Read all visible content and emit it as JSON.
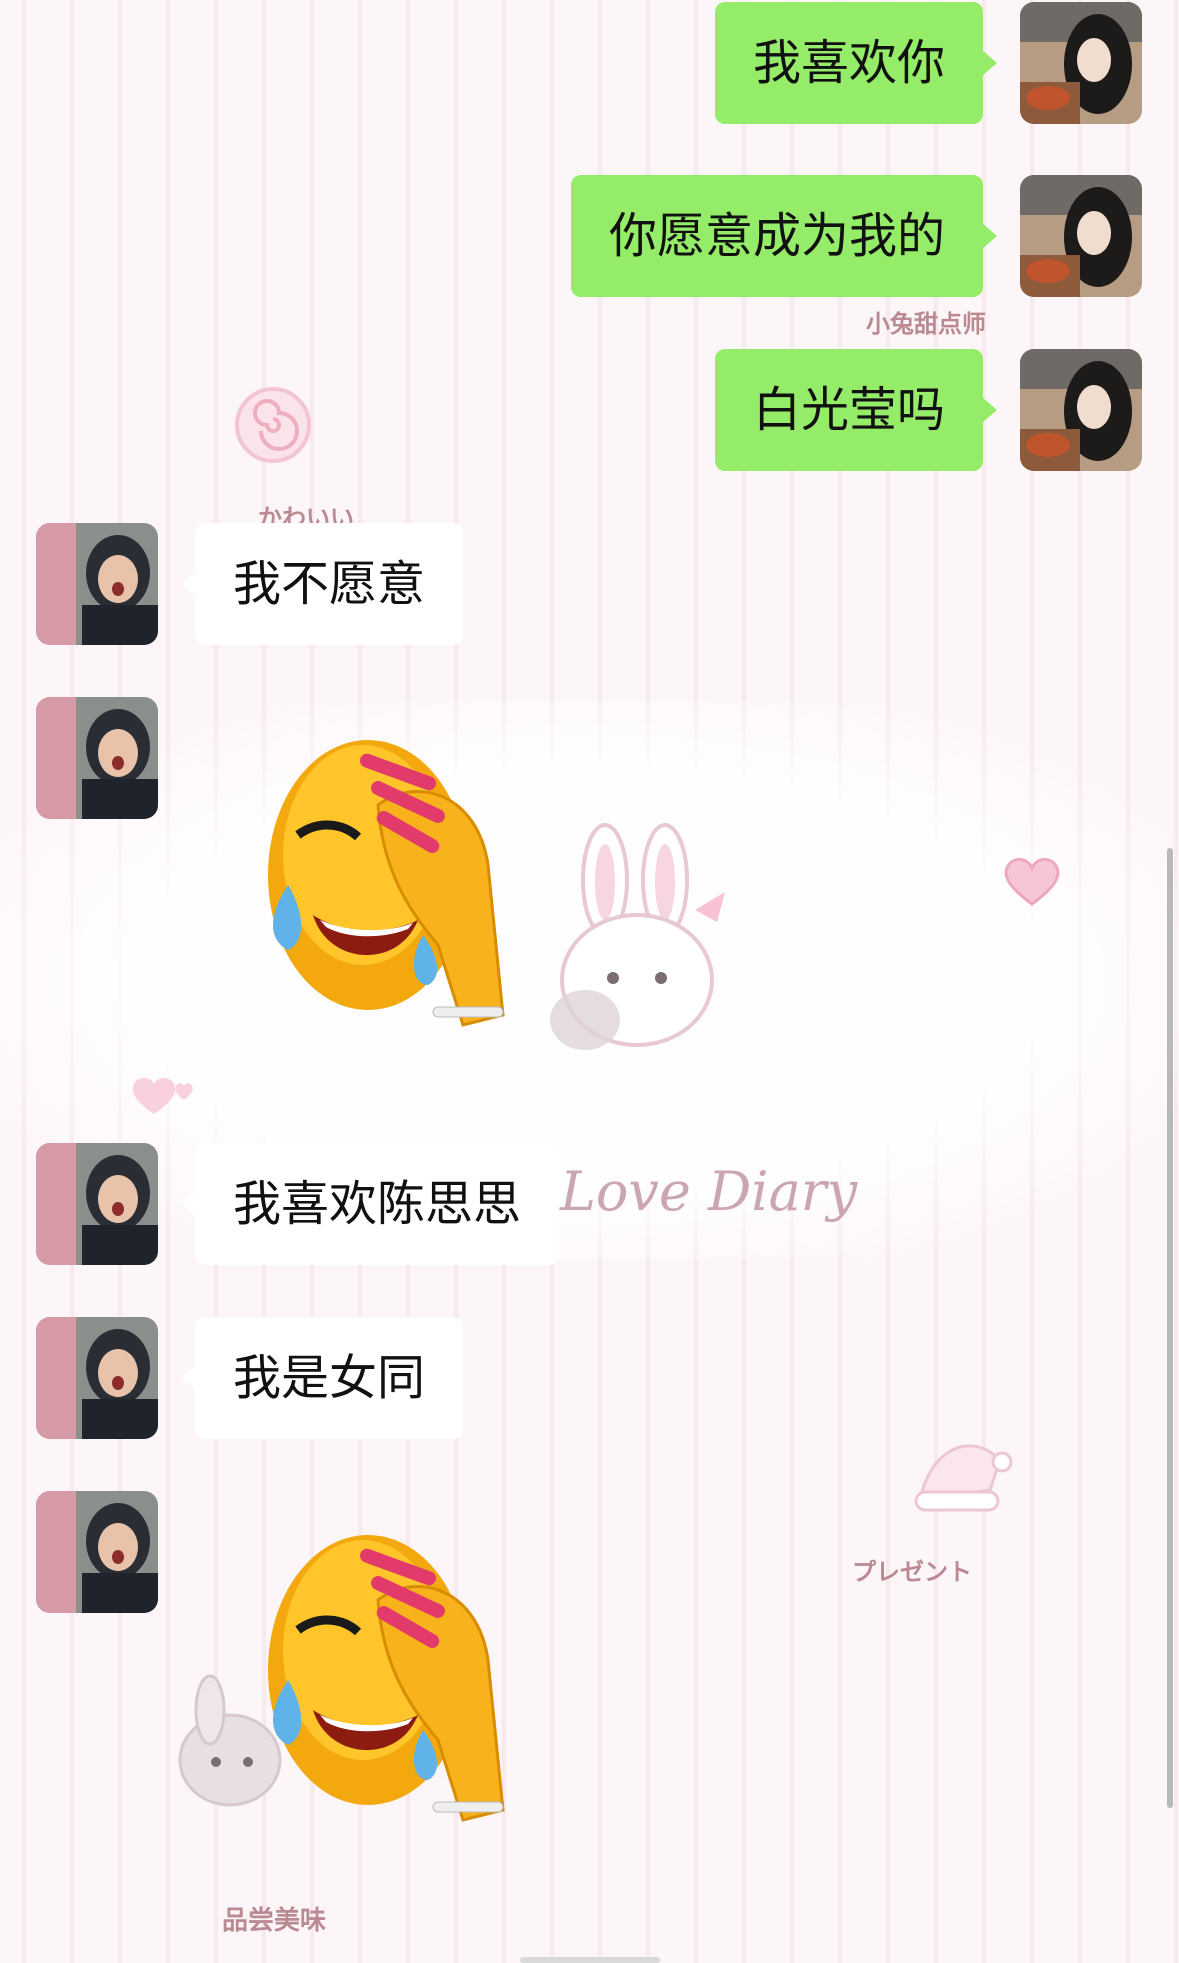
{
  "wallpaper": {
    "labels": {
      "bunny_sweets": "小兔甜点师",
      "kawaii": "かわいい",
      "love_diary": "Love Diary",
      "present": "プレゼント",
      "tasting": "品尝美味"
    }
  },
  "colors": {
    "my_bubble": "#95ec69",
    "their_bubble": "#ffffff"
  },
  "messages": [
    {
      "sender": "me",
      "text": "我喜欢你"
    },
    {
      "sender": "me",
      "text": "你愿意成为我的"
    },
    {
      "sender": "me",
      "text": "白光莹吗"
    },
    {
      "sender": "them",
      "text": "我不愿意"
    },
    {
      "sender": "them",
      "type": "sticker",
      "icon": "laughing-crying-facepalm-emoji"
    },
    {
      "sender": "them",
      "text": "我喜欢陈思思"
    },
    {
      "sender": "them",
      "text": "我是女同"
    },
    {
      "sender": "them",
      "type": "sticker",
      "icon": "laughing-crying-facepalm-emoji"
    }
  ]
}
